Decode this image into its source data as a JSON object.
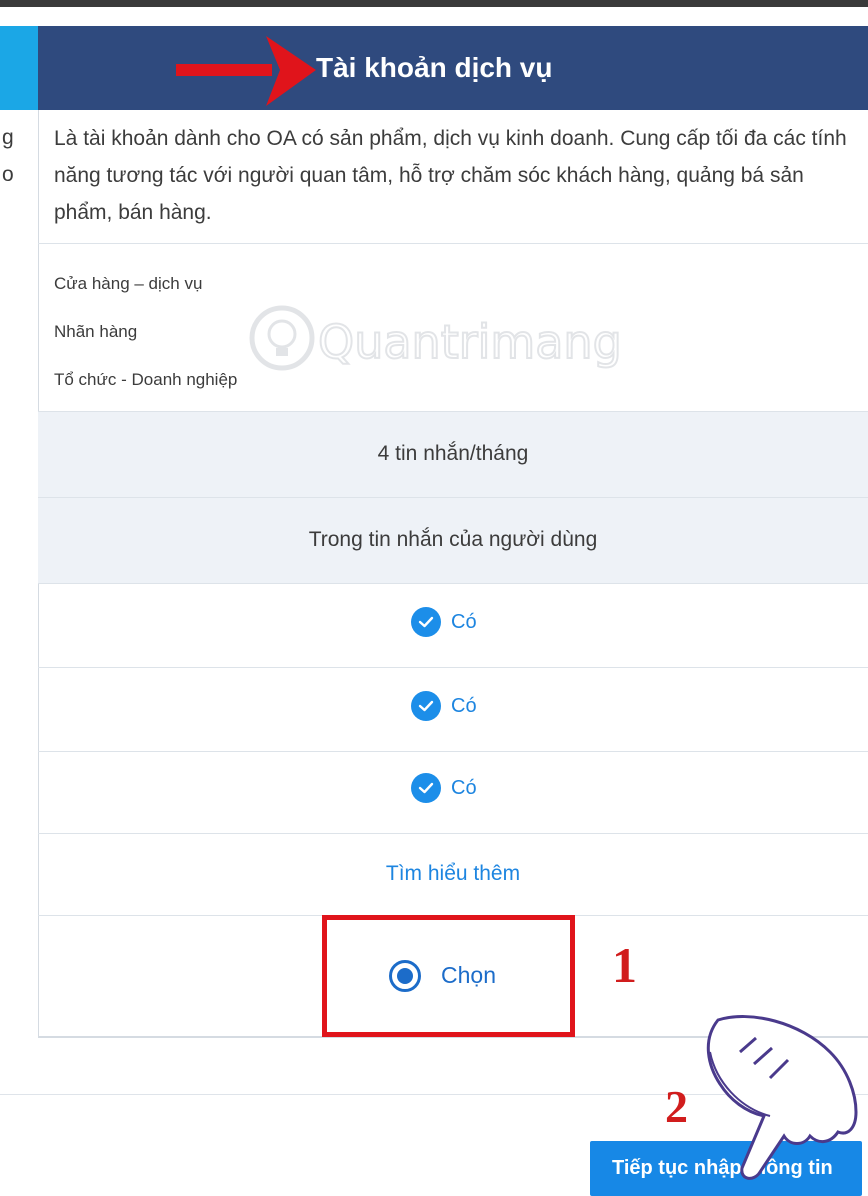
{
  "header": {
    "title": "Tài khoản dịch vụ"
  },
  "left_column_clipped": {
    "row1_line1": "g",
    "row1_line2": "o"
  },
  "description": "Là tài khoản dành cho OA có sản phẩm, dịch vụ kinh doanh. Cung cấp tối đa các tính năng tương tác với người quan tâm, hỗ trợ chăm sóc khách hàng, quảng bá sản phẩm, bán hàng.",
  "categories": [
    "Cửa hàng – dịch vụ",
    "Nhãn hàng",
    "Tổ chức - Doanh nghiệp"
  ],
  "message_quota": "4 tin nhắn/tháng",
  "message_location": "Trong tin nhắn của người dùng",
  "features": [
    {
      "label": "Có",
      "icon": "check-circle-icon"
    },
    {
      "label": "Có",
      "icon": "check-circle-icon"
    },
    {
      "label": "Có",
      "icon": "check-circle-icon"
    }
  ],
  "learn_more": "Tìm hiểu thêm",
  "select": {
    "label": "Chọn",
    "selected": true
  },
  "annotations": {
    "step1": "1",
    "step2": "2"
  },
  "continue_button": "Tiếp tục nhập thông tin",
  "watermark": "Quantrimang",
  "colors": {
    "header_bg": "#2f4a7e",
    "accent_blue": "#1c8ee9",
    "annotation_red": "#e0141b",
    "button_bg": "#1788e6"
  }
}
